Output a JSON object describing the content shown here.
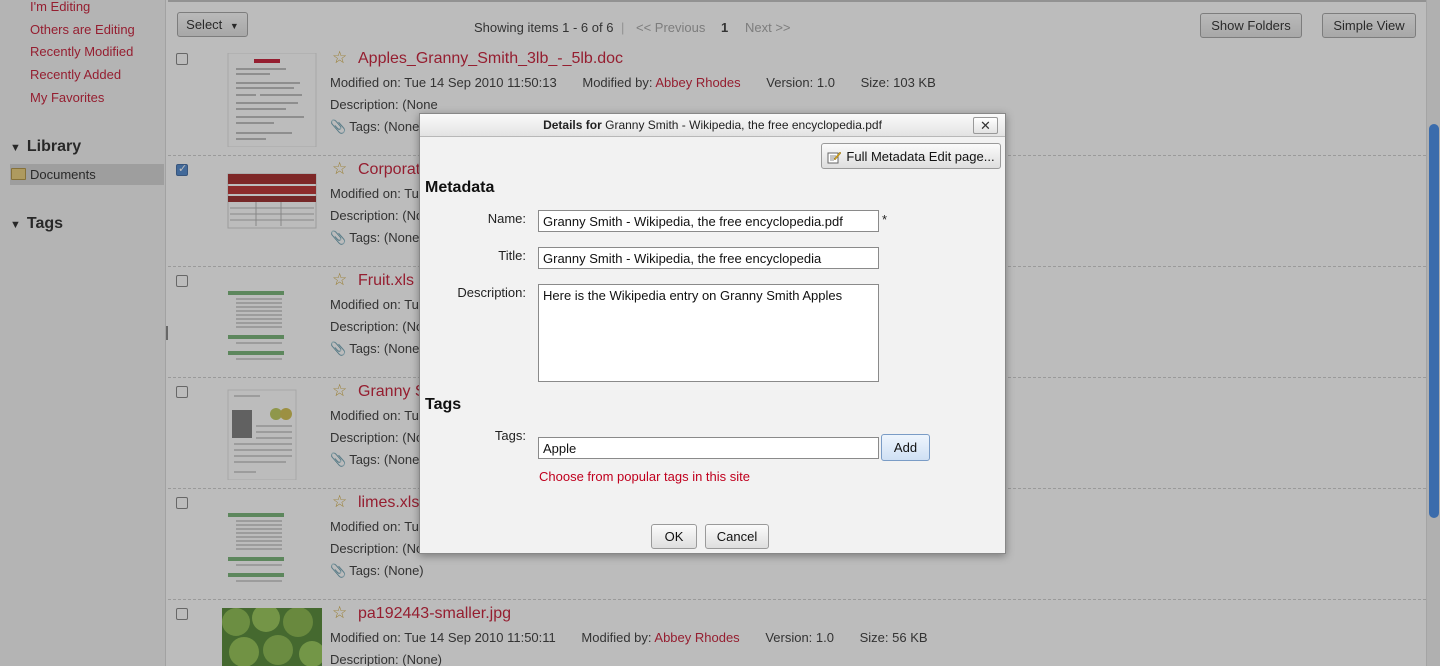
{
  "sidebar": {
    "links": [
      "I'm Editing",
      "Others are Editing",
      "Recently Modified",
      "Recently Added",
      "My Favorites"
    ],
    "library_heading": "Library",
    "documents_label": "Documents",
    "tags_heading": "Tags"
  },
  "toolbar": {
    "select_label": "Select",
    "showing": "Showing items 1 - 6 of 6",
    "previous": "<< Previous",
    "page": "1",
    "next": "Next >>",
    "show_folders": "Show Folders",
    "simple_view": "Simple View"
  },
  "labels": {
    "modified_on": "Modified on:",
    "modified_by": "Modified by:",
    "version": "Version:",
    "size": "Size:",
    "description": "Description:",
    "tags": "Tags:"
  },
  "documents": [
    {
      "name": "Apples_Granny_Smith_3lb_-_5lb.doc",
      "modified_on": "Tue 14 Sep 2010 11:50:13",
      "modified_by": "Abbey Rhodes",
      "version": "1.0",
      "size": "103 KB",
      "description": "(None",
      "tags": "(None",
      "checked": false
    },
    {
      "name": "Corporat",
      "modified_on": "Tu",
      "description": "(No",
      "tags": "(None",
      "checked": true
    },
    {
      "name": "Fruit.xls",
      "modified_on": "Tu",
      "description": "(No",
      "tags": "(None",
      "checked": false
    },
    {
      "name": "Granny S",
      "modified_on": "Tu",
      "description": "(No",
      "tags": "(None",
      "checked": false
    },
    {
      "name": "limes.xls",
      "modified_on": "Tu",
      "description": "(No",
      "tags": "(None)",
      "checked": false
    },
    {
      "name": "pa192443-smaller.jpg",
      "modified_on": "Tue 14 Sep 2010 11:50:11",
      "modified_by": "Abbey Rhodes",
      "version": "1.0",
      "size": "56 KB",
      "description": "(None)",
      "checked": false
    }
  ],
  "dialog": {
    "title_prefix": "Details for",
    "title_name": "Granny Smith - Wikipedia, the free encyclopedia.pdf",
    "close_glyph": "✕",
    "full_metadata_button": "Full Metadata Edit page...",
    "metadata_heading": "Metadata",
    "name_label": "Name:",
    "name_value": "Granny Smith - Wikipedia, the free encyclopedia.pdf",
    "required_marker": "*",
    "title_label": "Title:",
    "title_value": "Granny Smith - Wikipedia, the free encyclopedia",
    "description_label": "Description:",
    "description_value": "Here is the Wikipedia entry on Granny Smith Apples",
    "tags_heading": "Tags",
    "tags_label": "Tags:",
    "tags_value": "Apple",
    "add_button": "Add",
    "popular_tags_link": "Choose from popular tags in this site",
    "ok_button": "OK",
    "cancel_button": "Cancel"
  },
  "colors": {
    "link_red": "#c0001e",
    "scroll_blue": "#2f7fe5",
    "add_button_bg": "#dce9f7"
  }
}
